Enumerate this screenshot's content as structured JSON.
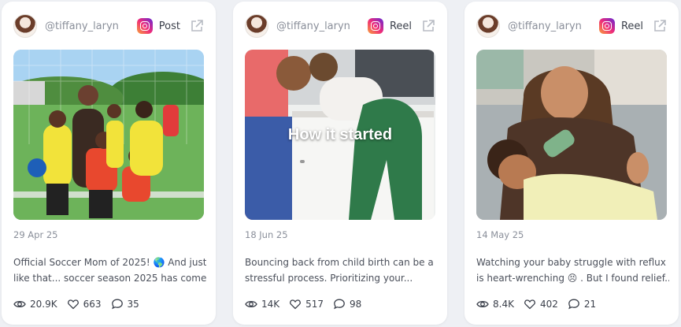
{
  "cards": [
    {
      "username": "@tiffany_laryn",
      "type": "Post",
      "date": "29 Apr 25",
      "caption_line1": "Official Soccer Mom of 2025! 🌎 And just",
      "caption_line2": "like that... soccer season 2025 has come...",
      "views": "20.9K",
      "likes": "663",
      "comments": "35"
    },
    {
      "username": "@tiffany_laryn",
      "type": "Reel",
      "overlay": "How it started",
      "date": "18 Jun 25",
      "caption_line1": "Bouncing back from child birth can be a",
      "caption_line2": "stressful process. Prioritizing your...",
      "views": "14K",
      "likes": "517",
      "comments": "98"
    },
    {
      "username": "@tiffany_laryn",
      "type": "Reel",
      "date": "14 May 25",
      "caption_line1": "Watching your baby struggle with reflux",
      "caption_line2": "is heart-wrenching 😣 . But I found relief...",
      "views": "8.4K",
      "likes": "402",
      "comments": "21"
    }
  ],
  "icons": {
    "platform": "instagram-icon",
    "external": "external-link-icon",
    "views": "eye-icon",
    "likes": "heart-icon",
    "comments": "comment-icon"
  },
  "colors": {
    "instagram_gradient": [
      "#f9a23a",
      "#ee2a7b",
      "#6228d7"
    ],
    "card_bg": "#ffffff",
    "page_bg": "#eef0f4"
  }
}
